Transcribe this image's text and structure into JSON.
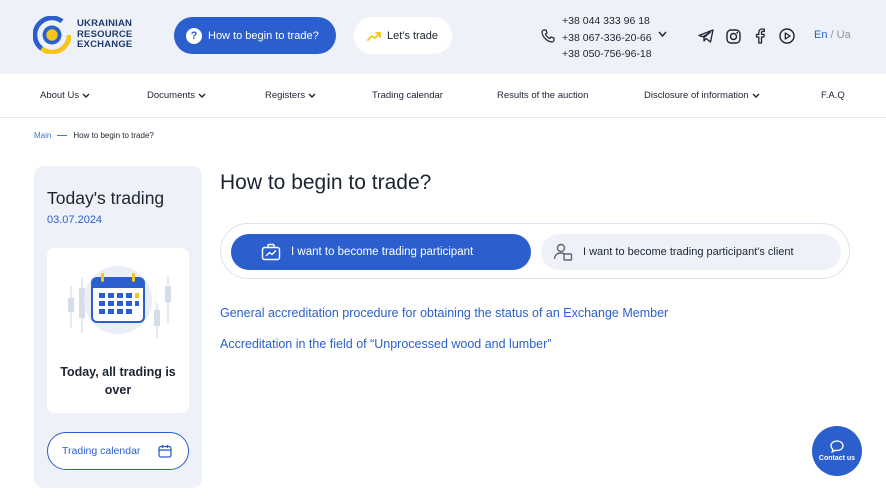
{
  "brand": {
    "line1": "UKRAINIAN",
    "line2": "RESOURCE",
    "line3": "EXCHANGE",
    "color_primary": "#2a5fcd",
    "color_accent_yellow": "#f5c518"
  },
  "header": {
    "begin_label": "How to begin to trade?",
    "trade_label": "Let's trade",
    "phones": [
      "+38 044 333 96 18",
      "+38 067-336-20-66",
      "+38 050-756-96-18"
    ],
    "social_icons": [
      "telegram-icon",
      "instagram-icon",
      "facebook-icon",
      "youtube-icon"
    ],
    "lang_en": "En",
    "lang_sep": " / ",
    "lang_ua": "Ua"
  },
  "nav": {
    "items": [
      {
        "label": "About Us",
        "dropdown": true
      },
      {
        "label": "Documents",
        "dropdown": true
      },
      {
        "label": "Registers",
        "dropdown": true
      },
      {
        "label": "Trading calendar",
        "dropdown": false
      },
      {
        "label": "Results of the auction",
        "dropdown": false
      },
      {
        "label": "Disclosure of information",
        "dropdown": true
      },
      {
        "label": "F.A.Q",
        "dropdown": false
      }
    ]
  },
  "breadcrumb": {
    "home": "Main",
    "current": "How to begin to trade?"
  },
  "sidebar": {
    "title": "Today's trading",
    "date": "03.07.2024",
    "status": "Today, all trading is over",
    "calendar_button": "Trading calendar"
  },
  "main": {
    "title": "How to begin to trade?",
    "tab_active": "I want to become trading participant",
    "tab_other": "I want to become trading participant's client",
    "links": [
      "General accreditation procedure for obtaining the status of an Exchange Member",
      "Accreditation in the field of “Unprocessed wood and lumber”"
    ]
  },
  "contact": {
    "label": "Contact us"
  }
}
